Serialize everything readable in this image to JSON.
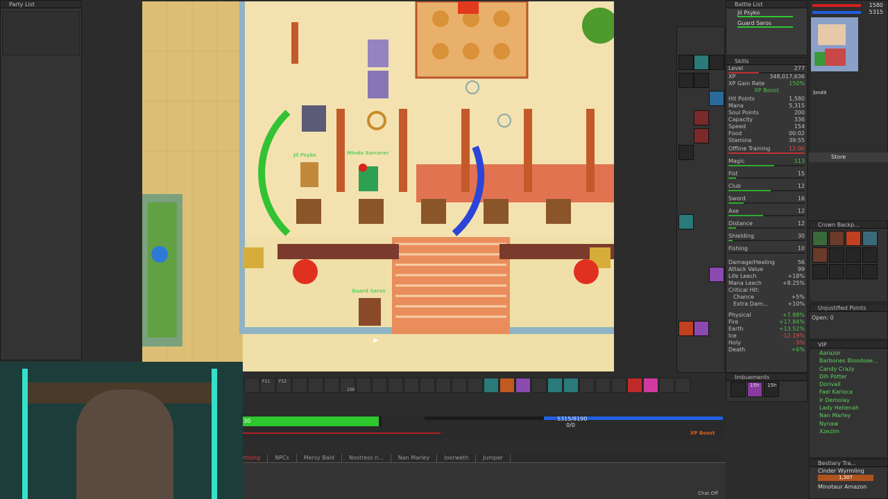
{
  "party_list": {
    "title": "Party List"
  },
  "battle_list": {
    "title": "Battle List",
    "entries": [
      "Jil Psyko",
      "Guard Saros"
    ]
  },
  "top_stats": {
    "hp": "1580",
    "mana": "5315"
  },
  "minimap": {
    "time": "3m49"
  },
  "store_label": "Store",
  "skills": {
    "title": "Skills",
    "level_label": "Level",
    "level_value": "277",
    "xp_label": "XP",
    "xp_value": "348,017,636",
    "xp_gain_label": "XP Gain Rate",
    "xp_gain_value": "150%",
    "xp_boost_label": "XP Boost",
    "rows": [
      {
        "label": "Hit Points",
        "value": "1,580"
      },
      {
        "label": "Mana",
        "value": "5,315"
      },
      {
        "label": "Soul Points",
        "value": "200"
      },
      {
        "label": "Capacity",
        "value": "336"
      },
      {
        "label": "Speed",
        "value": "154"
      },
      {
        "label": "Food",
        "value": "00:02"
      },
      {
        "label": "Stamina",
        "value": "39:55"
      }
    ],
    "offline_label": "Offline Training",
    "offline_value": "12:00",
    "combat": [
      {
        "label": "Magic",
        "value": "113",
        "fill": 0.6,
        "color": "#52c24e"
      },
      {
        "label": "Fist",
        "value": "15",
        "fill": 0.1
      },
      {
        "label": "Club",
        "value": "12",
        "fill": 0.55
      },
      {
        "label": "Sword",
        "value": "16",
        "fill": 0.2
      },
      {
        "label": "Axe",
        "value": "12",
        "fill": 0.45
      },
      {
        "label": "Distance",
        "value": "12",
        "fill": 0.1
      },
      {
        "label": "Shielding",
        "value": "30",
        "fill": 0.05
      },
      {
        "label": "Fishing",
        "value": "10",
        "fill": 0.0
      }
    ],
    "misc": [
      {
        "label": "Damage/Healing",
        "value": "56"
      },
      {
        "label": "Attack Value",
        "value": "99"
      },
      {
        "label": "Life Leech",
        "value": "+18%"
      },
      {
        "label": "Mana Leech",
        "value": "+8.25%"
      }
    ],
    "crit_label": "Critical Hit:",
    "crit": [
      {
        "label": "Chance",
        "value": "+5%"
      },
      {
        "label": "Extra Dam...",
        "value": "+10%"
      }
    ],
    "elements": [
      {
        "label": "Physical",
        "value": "+7.88%",
        "color": "#52c24e"
      },
      {
        "label": "Fire",
        "value": "+17.84%",
        "color": "#52c24e"
      },
      {
        "label": "Earth",
        "value": "+13.52%",
        "color": "#52c24e"
      },
      {
        "label": "Ice",
        "value": "-12.19%",
        "color": "#e05050"
      },
      {
        "label": "Holy",
        "value": "-3%",
        "color": "#e05050"
      },
      {
        "label": "Death",
        "value": "+6%",
        "color": "#52c24e"
      }
    ]
  },
  "backpack": {
    "title": "Crown Backp..."
  },
  "unjustified": {
    "title": "Unjustified Points",
    "open_label": "Open: 0"
  },
  "vip": {
    "title": "VIP",
    "names": [
      "Aarazor",
      "Barbones Bloodsee...",
      "Candy Crazy",
      "Dih Potter",
      "Dorivall",
      "Fael Karioca",
      "Ir Demolay",
      "Lady Hellenah",
      "Nan Marley",
      "Nynaw",
      "Xzezim"
    ]
  },
  "imbuements": {
    "title": "Imbuements",
    "timers": [
      "15h",
      "15h"
    ]
  },
  "bestiary": {
    "title": "Bestiary Tra...",
    "entries": [
      {
        "name": "Cinder Wyrmling",
        "count": "1,307"
      },
      {
        "name": "Minotaur Amazon",
        "count": ""
      }
    ]
  },
  "game": {
    "player_name": "Jil Psyko",
    "npc_name": "Mindo Sorcerer",
    "guard_name": "Guard Saros"
  },
  "status": {
    "health_text": "30",
    "mana_text": "5315/8190",
    "cap_text": "0/0",
    "xp_boost": "XP Boost",
    "health_fill": 0.98,
    "mana_fill": 0.6
  },
  "hotbar": {
    "labels": [
      "F11",
      "F12",
      "100"
    ]
  },
  "chat": {
    "tabs": [
      "rtising",
      "NPCs",
      "Mersy Bald",
      "Nostress n...",
      "Nan Marley",
      "Ioorweth",
      "Jumper"
    ],
    "chat_off": "Chat Off"
  },
  "colors": {
    "hp": "#d82020",
    "mana": "#2060e0",
    "green": "#2eaa2e",
    "vip": "#5fd35f"
  }
}
